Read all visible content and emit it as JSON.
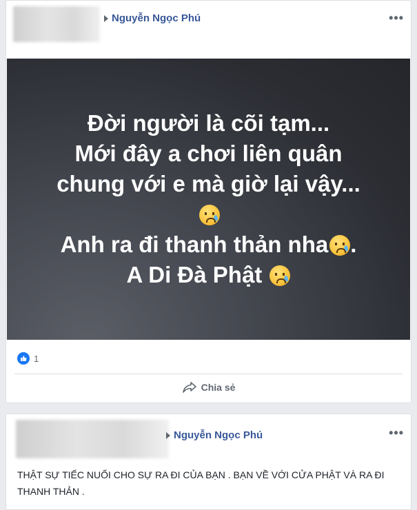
{
  "post1": {
    "author": "Nguyễn Ngọc Phú",
    "image_lines": [
      "Đời người là cõi tạm...",
      "Mới đây a chơi liên quân",
      "chung với e mà giờ lại vậy...",
      "",
      "Anh ra đi thanh thản nha",
      "A Di Đà Phật"
    ],
    "image_line_suffix": {
      "line_4": ".",
      "emoji": "sad-but-relieved-face"
    },
    "reaction_count": "1",
    "share_label": "Chia sẻ",
    "more_label": "•••"
  },
  "post2": {
    "author": "Nguyễn Ngọc Phú",
    "text": "THẬT SỰ TIẾC NUỐI CHO SỰ RA ĐI CỦA BẠN . BẠN VỀ VỚI CỬA PHẬT VÀ RA ĐI THANH THẢN .",
    "more_label": "•••"
  },
  "colors": {
    "author_link": "#385898",
    "like_blue": "#1877f2",
    "page_bg": "#e9ebee"
  }
}
